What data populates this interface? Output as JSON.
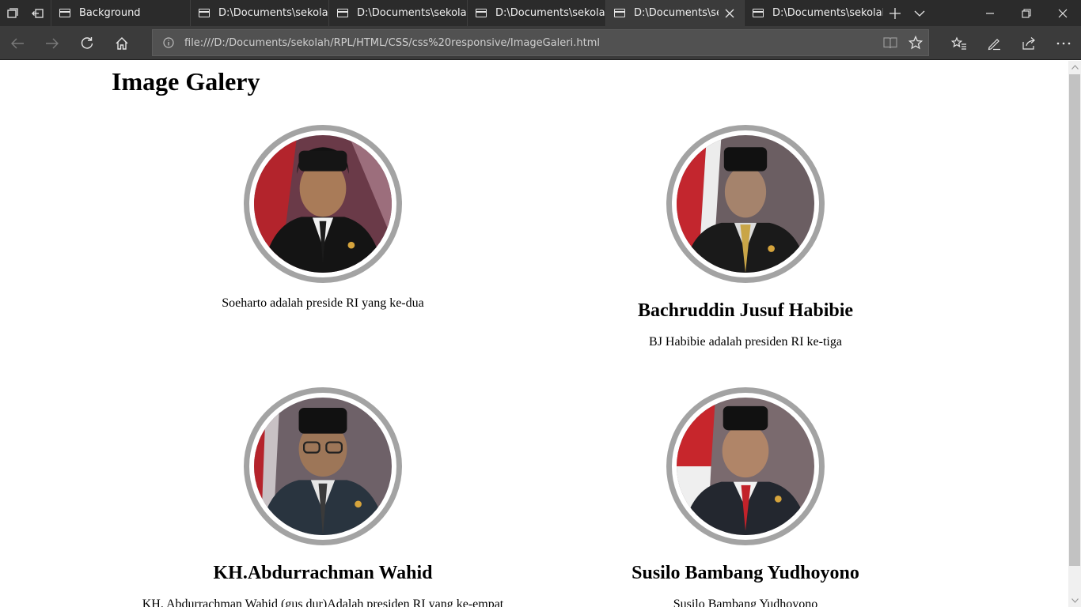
{
  "browser": {
    "tabs": [
      {
        "title": "Background",
        "active": false
      },
      {
        "title": "D:\\Documents\\sekolah\\",
        "active": false
      },
      {
        "title": "D:\\Documents\\sekolah\\",
        "active": false
      },
      {
        "title": "D:\\Documents\\sekolah\\",
        "active": false
      },
      {
        "title": "D:\\Documents\\sekol",
        "active": true
      },
      {
        "title": "D:\\Documents\\sekolah\\",
        "active": false
      }
    ],
    "url": "file:///D:/Documents/sekolah/RPL/HTML/CSS/css%20responsive/ImageGaleri.html",
    "icons": {
      "tab_actions": "tab-actions-icon",
      "set_aside": "set-aside-tabs-icon",
      "new_tab": "plus-icon",
      "tab_list": "chevron-down-icon",
      "back": "back-arrow-icon",
      "forward": "forward-arrow-icon",
      "refresh": "refresh-icon",
      "home": "home-icon",
      "reading_view": "book-icon",
      "favorite": "star-icon",
      "favorites_hub": "favorites-icon",
      "notes": "pen-icon",
      "share": "share-icon",
      "more": "more-icon"
    },
    "colors": {
      "chrome_dark": "#2b2b2b",
      "chrome": "#3b3b3b",
      "address": "#515151"
    }
  },
  "page": {
    "title": "Image Galery",
    "cards": [
      {
        "name": "",
        "caption": "Soeharto adalah preside RI yang ke-dua"
      },
      {
        "name": "Bachruddin Jusuf Habibie",
        "caption": "BJ Habibie adalah presiden RI ke-tiga"
      },
      {
        "name": "KH.Abdurrachman Wahid",
        "caption": "KH. Abdurrachman Wahid (gus dur)Adalah presiden RI yang ke-empat"
      },
      {
        "name": "Susilo Bambang Yudhoyono",
        "caption": "Susilo Bambang Yudhoyono"
      }
    ],
    "colors": {
      "photo_ring": "#a3a3a3"
    }
  }
}
